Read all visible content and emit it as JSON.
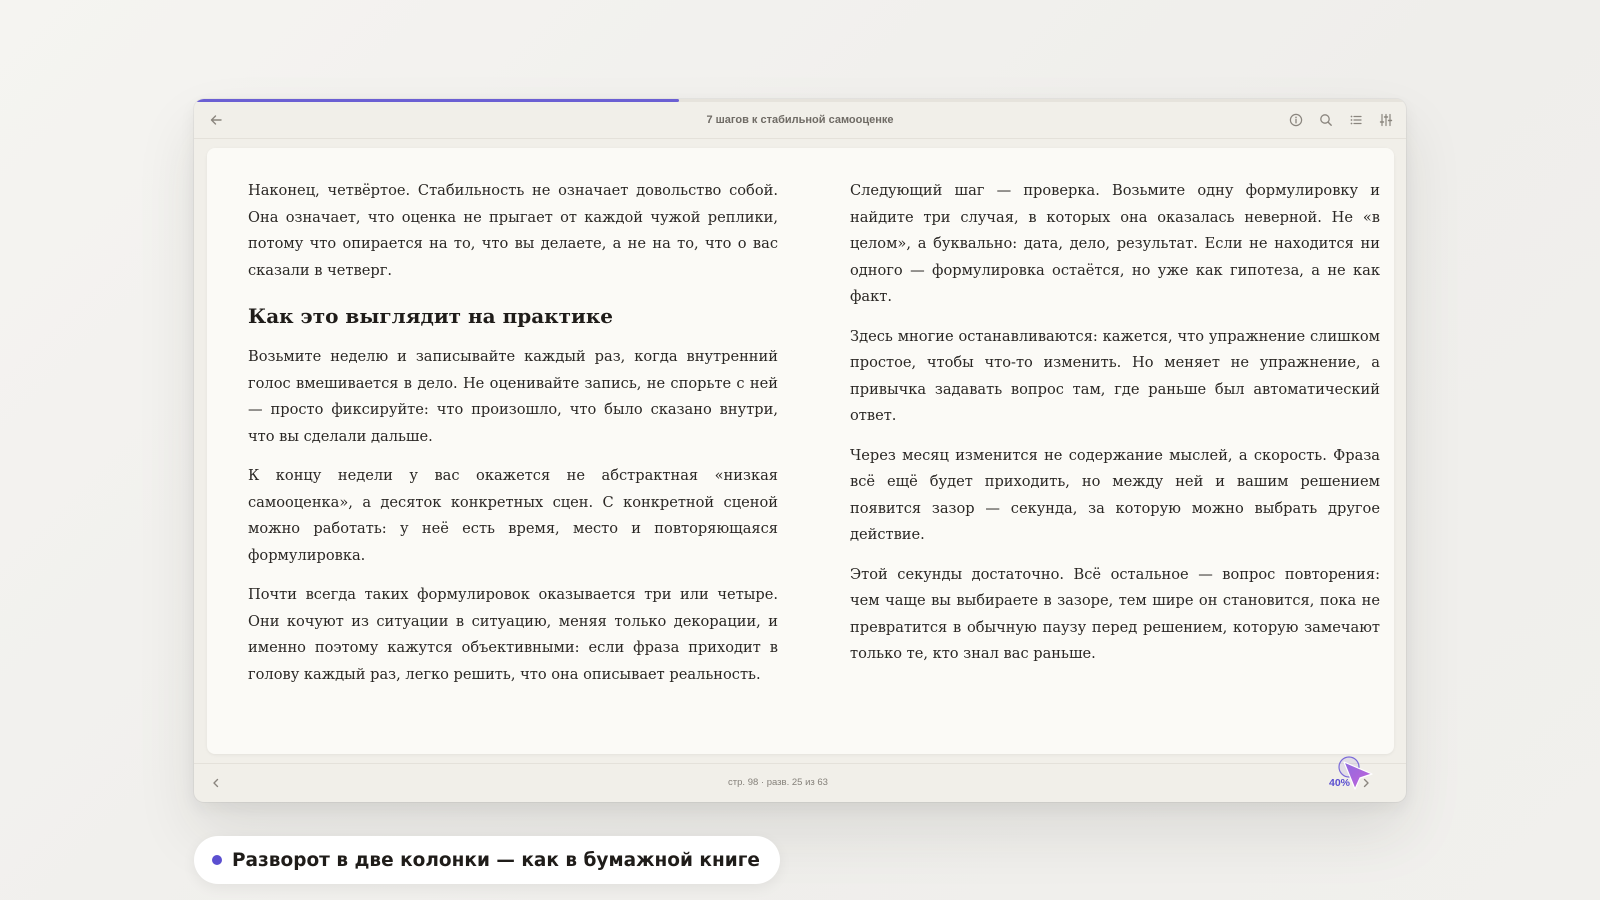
{
  "reader": {
    "title": "7 шагов к стабильной самооценке",
    "progress_percent": 40,
    "accent_color": "#6b5fd3",
    "icons": {
      "back": "arrow-left-icon",
      "info": "info-icon",
      "search": "search-icon",
      "toc": "list-icon",
      "settings": "sliders-icon",
      "prev": "chevron-left-icon",
      "next": "chevron-right-icon"
    }
  },
  "content": {
    "left_column": {
      "p1": "Наконец, четвёртое. Стабильность не означает довольство собой. Она означает, что оценка не прыгает от каждой чужой реплики, потому что опирается на то, что вы делаете, а не на то, что о вас сказали в четверг.",
      "heading": "Как это выглядит на практике",
      "p2": "Возьмите неделю и записывайте каждый раз, когда внутренний голос вмешивается в дело. Не оценивайте запись, не спорьте с ней — просто фиксируйте: что произошло, что было сказано внутри, что вы сделали дальше.",
      "p3": "К концу недели у вас окажется не абстрактная «низкая самооценка», а десяток конкретных сцен. С конкретной сценой можно работать: у неё есть время, место и повторяющаяся формулировка.",
      "p4": "Почти всегда таких формулировок оказывается три или четыре. Они кочуют из ситуации в ситуацию, меняя только декорации, и именно поэтому кажутся объективными: если фраза приходит в голову каждый раз, легко решить, что она описывает реальность."
    },
    "right_column": {
      "p1": "Следующий шаг — проверка. Возьмите одну формулировку и найдите три случая, в которых она оказалась неверной. Не «в целом», а буквально: дата, дело, результат. Если не находится ни одного — формулировка остаётся, но уже как гипотеза, а не как факт.",
      "p2": "Здесь многие останавливаются: кажется, что упражнение слишком простое, чтобы что-то изменить. Но меняет не упражнение, а привычка задавать вопрос там, где раньше был автоматический ответ.",
      "p3": "Через месяц изменится не содержание мыслей, а скорость. Фраза всё ещё будет приходить, но между ней и вашим решением появится зазор — секунда, за которую можно выбрать другое действие.",
      "p4": "Этой секунды достаточно. Всё остальное — вопрос повторения: чем чаще вы выбираете в зазоре, тем шире он становится, пока не превратится в обычную паузу перед решением, которую замечают только те, кто знал вас раньше."
    }
  },
  "footer": {
    "page_info": "стр. 98 · разв. 25 из 63",
    "percent_label": "40%"
  },
  "caption": {
    "text": "Разворот в две колонки — как в бумажной книге"
  }
}
